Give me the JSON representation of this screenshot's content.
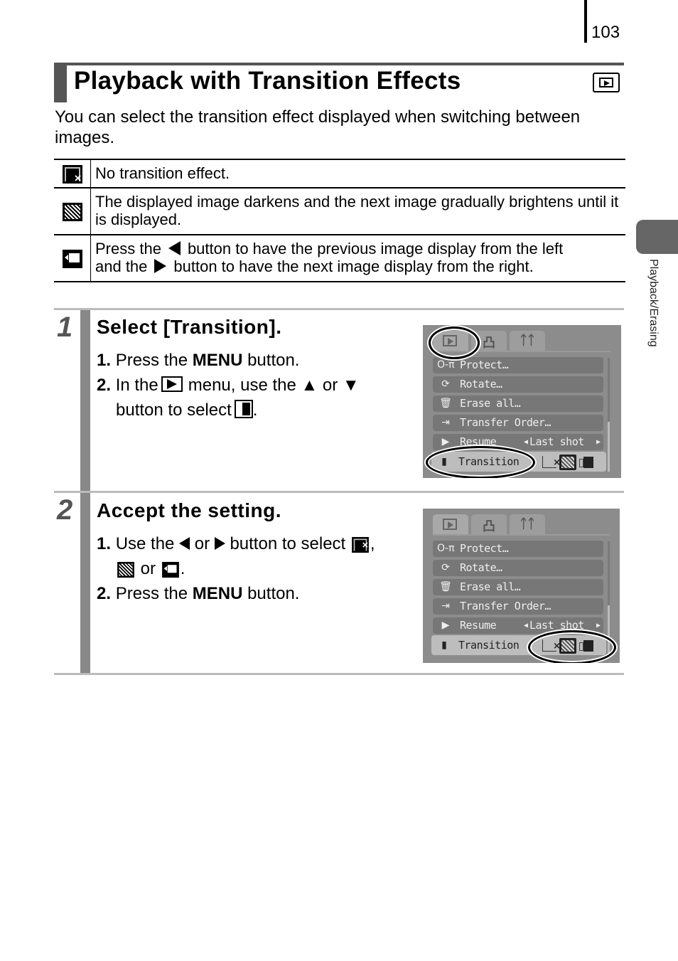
{
  "page_number": "103",
  "section_title": "Playback with Transition Effects",
  "mode_icon": "playback-mode-icon",
  "intro": "You can select the transition effect displayed when switching between images.",
  "effects_table": [
    {
      "icon": "no-transition-icon",
      "text": "No transition effect."
    },
    {
      "icon": "fade-transition-icon",
      "text": "The displayed image darkens and the next image gradually brightens until it is displayed."
    },
    {
      "icon": "slide-transition-icon",
      "parts": [
        "Press the",
        "button to have the previous image display from the left",
        "and the",
        "button to have the next image display from the right."
      ]
    }
  ],
  "steps": [
    {
      "number": "1",
      "title": "Select [Transition].",
      "items": [
        {
          "num": "1.",
          "pre": "Press the ",
          "bold": "MENU",
          "post": " button."
        },
        {
          "num": "2.",
          "pre": "In the",
          "mid": "menu, use the ▲ or ▼",
          "line2": "button to select",
          "end": "."
        }
      ],
      "screen": {
        "tabs": [
          "playback",
          "print",
          "setup"
        ],
        "tab_glyphs": [
          "",
          "凸",
          "ᛏᛏ"
        ],
        "menu": [
          {
            "icon": "O‑π",
            "label": "Protect…"
          },
          {
            "icon": "⟳",
            "label": "Rotate…"
          },
          {
            "icon": "🗑",
            "label": "Erase all…"
          },
          {
            "icon": "⇥",
            "label": "Transfer Order…"
          },
          {
            "icon": "▶",
            "label": "Resume",
            "value": "Last shot"
          },
          {
            "icon": "▮",
            "label": "Transition"
          }
        ],
        "highlighted": [
          "playback-tab",
          "transition-item"
        ]
      }
    },
    {
      "number": "2",
      "title": "Accept the setting.",
      "items": [
        {
          "num": "1.",
          "pre": "Use the",
          "mid1": "or",
          "mid2": "button to select",
          "comma": ",",
          "or": "or",
          "end": "."
        },
        {
          "num": "2.",
          "pre": "Press the ",
          "bold": "MENU",
          "post": " button."
        }
      ],
      "screen": {
        "highlighted": [
          "transition-options"
        ]
      }
    }
  ],
  "side_tab_label": "Playback/Erasing"
}
